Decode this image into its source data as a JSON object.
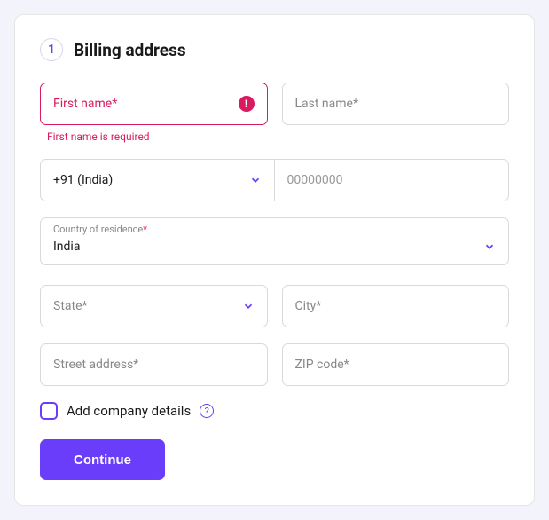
{
  "step_number": "1",
  "title": "Billing address",
  "first_name": {
    "placeholder": "First name*",
    "error": "First name is required"
  },
  "last_name": {
    "placeholder": "Last name*"
  },
  "phone": {
    "code_display": "+91 (India)",
    "placeholder": "00000000"
  },
  "country": {
    "label": "Country of residence",
    "required_mark": "*",
    "value": "India"
  },
  "state": {
    "placeholder": "State*"
  },
  "city": {
    "placeholder": "City*"
  },
  "street": {
    "placeholder": "Street address*"
  },
  "zip": {
    "placeholder": "ZIP code*"
  },
  "company_checkbox_label": "Add company details",
  "help_glyph": "?",
  "error_glyph": "!",
  "continue_label": "Continue"
}
